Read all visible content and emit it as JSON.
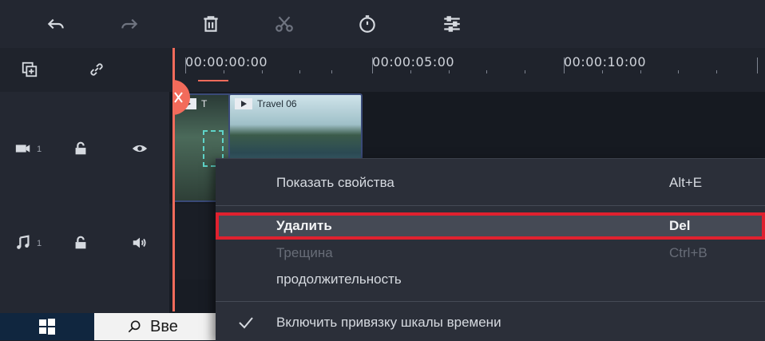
{
  "toolbar": {
    "icons": [
      "undo-icon",
      "redo-icon",
      "delete-icon",
      "split-icon",
      "speed-icon",
      "adjust-icon"
    ]
  },
  "ruler": {
    "timecodes": [
      "00:00:00:00",
      "00:00:05:00",
      "00:00:10:00"
    ]
  },
  "tracks": {
    "video": {
      "number": "1"
    },
    "audio": {
      "number": "1"
    }
  },
  "clips": {
    "clip1_label": "T",
    "clip2_label": "Travel 06"
  },
  "context_menu": {
    "items": [
      {
        "label": "Показать свойства",
        "shortcut": "Alt+E"
      },
      {
        "label": "Удалить",
        "shortcut": "Del"
      },
      {
        "label": "Трещина",
        "shortcut": "Ctrl+B"
      },
      {
        "label": "продолжительность",
        "shortcut": ""
      },
      {
        "label": "Включить привязку шкалы времени",
        "shortcut": ""
      }
    ]
  },
  "taskbar": {
    "search_text": "Вве"
  },
  "colors": {
    "playhead": "#f26b5b",
    "highlight_border": "#e0212f",
    "clip_border": "#3a4a78"
  }
}
